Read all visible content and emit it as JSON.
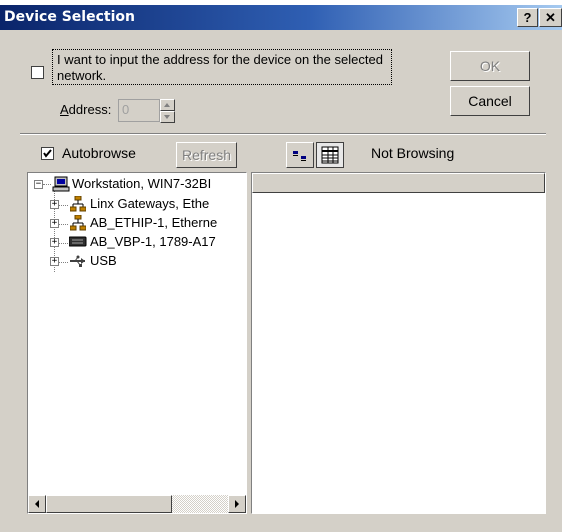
{
  "dialog": {
    "title": "Device Selection",
    "help_button": "?",
    "close_button": "✕"
  },
  "address_input": {
    "checkbox_label": "I want to input the address for the device on the selected network.",
    "checked": false,
    "address_label": "Address:",
    "address_value": "0"
  },
  "buttons": {
    "ok": "OK",
    "cancel": "Cancel",
    "refresh": "Refresh"
  },
  "browse": {
    "autobrowse_label": "Autobrowse",
    "autobrowse_checked": true,
    "status": "Not Browsing"
  },
  "tree": {
    "root": {
      "label": "Workstation, WIN7-32BI",
      "icon": "computer-icon",
      "expanded": true
    },
    "children": [
      {
        "label": "Linx Gateways, Ethe",
        "icon": "network-icon"
      },
      {
        "label": "AB_ETHIP-1, Etherne",
        "icon": "network-icon"
      },
      {
        "label": "AB_VBP-1, 1789-A17",
        "icon": "backplane-icon"
      },
      {
        "label": "USB",
        "icon": "usb-icon"
      }
    ]
  },
  "colors": {
    "title_bar_start": "#0a246a",
    "title_bar_end": "#a6caf0",
    "face": "#d4d0c8"
  }
}
